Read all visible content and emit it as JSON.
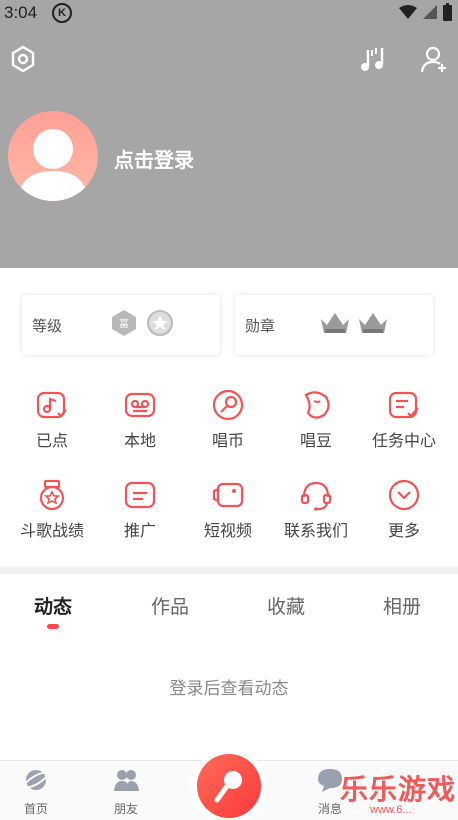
{
  "status": {
    "time": "3:04",
    "k": "K"
  },
  "profile": {
    "login_text": "点击登录"
  },
  "cards": {
    "level_label": "等级",
    "medal_label": "勋章",
    "level_badge_text": "富"
  },
  "grid": [
    {
      "label": "已点",
      "icon": "music-note-icon"
    },
    {
      "label": "本地",
      "icon": "cassette-icon"
    },
    {
      "label": "唱币",
      "icon": "coin-icon"
    },
    {
      "label": "唱豆",
      "icon": "bean-icon"
    },
    {
      "label": "任务中心",
      "icon": "task-icon"
    },
    {
      "label": "斗歌战绩",
      "icon": "medal-icon"
    },
    {
      "label": "推广",
      "icon": "promote-icon"
    },
    {
      "label": "短视频",
      "icon": "video-icon"
    },
    {
      "label": "联系我们",
      "icon": "headset-icon"
    },
    {
      "label": "更多",
      "icon": "more-icon"
    }
  ],
  "tabs": [
    "动态",
    "作品",
    "收藏",
    "相册"
  ],
  "active_tab": "动态",
  "empty_text": "登录后查看动态",
  "bottom_nav": [
    "首页",
    "朋友",
    "消息"
  ],
  "watermark": {
    "title": "乐乐游戏",
    "url": "www.6..."
  },
  "colors": {
    "accent": "#ff4a4a",
    "header_bg": "#a6a6a6",
    "icon_red": "#f05555"
  }
}
